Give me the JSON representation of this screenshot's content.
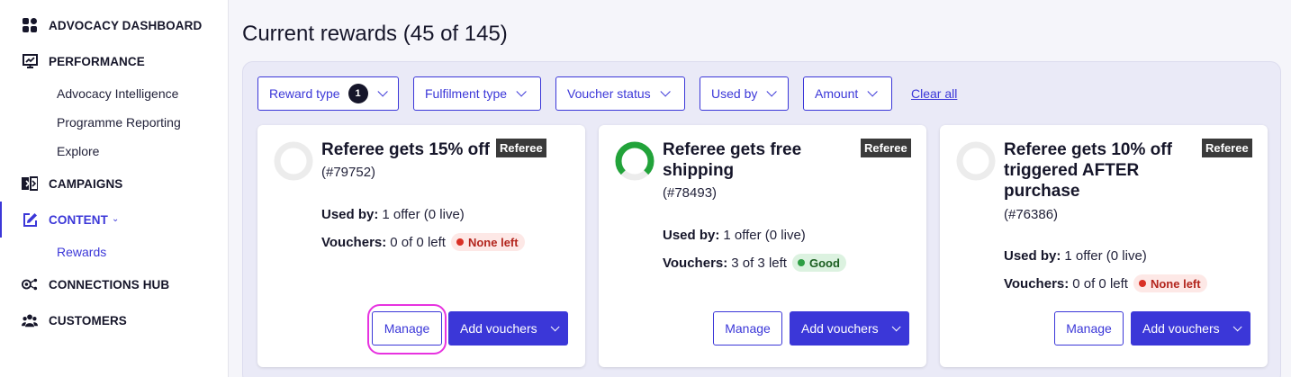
{
  "sidebar": {
    "items": [
      {
        "label": "ADVOCACY DASHBOARD",
        "icon": "dashboard-icon"
      },
      {
        "label": "PERFORMANCE",
        "icon": "chart-icon"
      },
      {
        "label": "CAMPAIGNS",
        "icon": "campaign-icon"
      },
      {
        "label": "CONTENT",
        "icon": "edit-icon"
      },
      {
        "label": "CONNECTIONS HUB",
        "icon": "connections-icon"
      },
      {
        "label": "CUSTOMERS",
        "icon": "users-icon"
      }
    ],
    "performance_sub": [
      "Advocacy Intelligence",
      "Programme Reporting",
      "Explore"
    ],
    "content_sub": [
      "Rewards"
    ],
    "accent": "#3b37d8"
  },
  "main": {
    "title": "Current rewards (45 of 145)",
    "filters": [
      {
        "label": "Reward type",
        "count": "1"
      },
      {
        "label": "Fulfilment type"
      },
      {
        "label": "Voucher status"
      },
      {
        "label": "Used by"
      },
      {
        "label": "Amount"
      }
    ],
    "clear_all": "Clear all"
  },
  "cards": [
    {
      "title": "Referee gets 15% off",
      "id": "(#79752)",
      "tag": "Referee",
      "used_by_label": "Used by:",
      "used_by": "1 offer (0 live)",
      "vouchers_label": "Vouchers:",
      "vouchers": "0 of 0 left",
      "status": "None left",
      "status_color": "#d93025",
      "manage": "Manage",
      "add": "Add vouchers"
    },
    {
      "title": "Referee gets free shipping",
      "id": "(#78493)",
      "tag": "Referee",
      "used_by_label": "Used by:",
      "used_by": "1 offer (0 live)",
      "vouchers_label": "Vouchers:",
      "vouchers": "3 of 3 left",
      "status": "Good",
      "status_color": "#2e9e44",
      "manage": "Manage",
      "add": "Add vouchers"
    },
    {
      "title": "Referee gets 10% off triggered AFTER purchase",
      "id": "(#76386)",
      "tag": "Referee",
      "used_by_label": "Used by:",
      "used_by": "1 offer (0 live)",
      "vouchers_label": "Vouchers:",
      "vouchers": "0 of 0 left",
      "status": "None left",
      "status_color": "#d93025",
      "manage": "Manage",
      "add": "Add vouchers"
    }
  ]
}
